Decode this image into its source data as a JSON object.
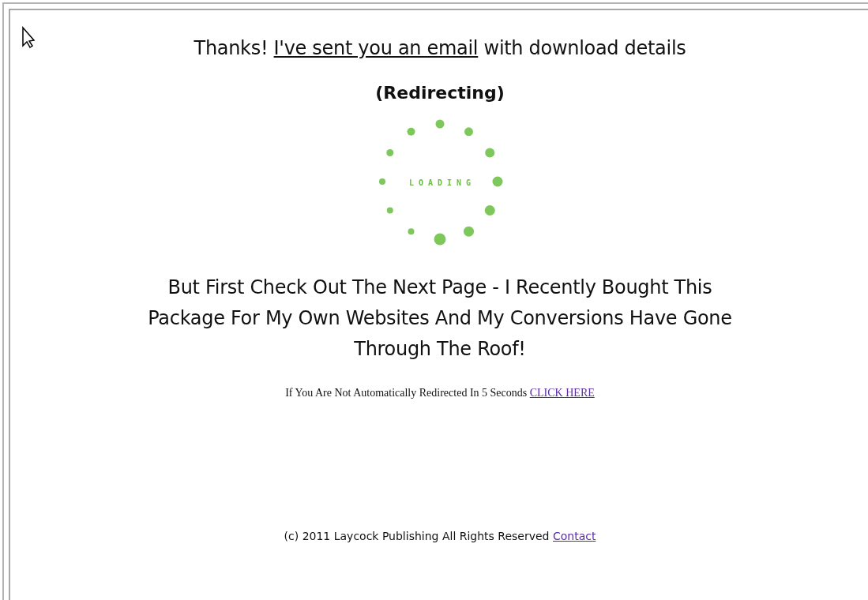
{
  "heading": {
    "before": "Thanks! ",
    "link": "I've sent you an email",
    "after": " with download details"
  },
  "status": "(Redirecting)",
  "spinner": {
    "label": "LOADING"
  },
  "message": "But First Check Out The Next Page - I Recently Bought This Package For My Own Websites And My Conversions Have Gone Through The Roof!",
  "redirect_note": {
    "text": "If You Are Not Automatically Redirected In 5 Seconds ",
    "link": "CLICK HERE"
  },
  "footer": {
    "text": "(c) 2011 Laycock Publishing All Rights Reserved ",
    "link": "Contact"
  }
}
